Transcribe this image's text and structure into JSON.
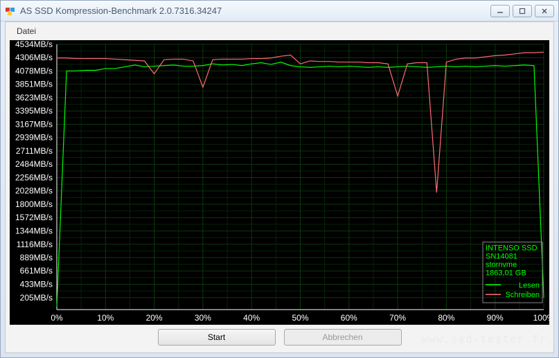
{
  "window": {
    "title": "AS SSD Kompression-Benchmark 2.0.7316.34247"
  },
  "menu": {
    "file": "Datei"
  },
  "legend": {
    "device": "INTENSO SSD",
    "serial": "SN14081",
    "driver": "stornvme",
    "capacity": "1863,01 GB",
    "read": "Lesen",
    "write": "Schreiben"
  },
  "buttons": {
    "start": "Start",
    "cancel": "Abbrechen"
  },
  "watermark": "www.ssd-tester.fr",
  "chart_data": {
    "type": "line",
    "title": "",
    "xlabel": "",
    "ylabel": "",
    "xlim": [
      0,
      100
    ],
    "ylim": [
      0,
      4534
    ],
    "x_tick_labels": [
      "0%",
      "10%",
      "20%",
      "30%",
      "40%",
      "50%",
      "60%",
      "70%",
      "80%",
      "90%",
      "100%"
    ],
    "y_tick_labels": [
      "205MB/s",
      "433MB/s",
      "661MB/s",
      "889MB/s",
      "1116MB/s",
      "1344MB/s",
      "1572MB/s",
      "1800MB/s",
      "2028MB/s",
      "2256MB/s",
      "2484MB/s",
      "2711MB/s",
      "2939MB/s",
      "3167MB/s",
      "3395MB/s",
      "3623MB/s",
      "3851MB/s",
      "4078MB/s",
      "4306MB/s",
      "4534MB/s"
    ],
    "y_tick_values": [
      205,
      433,
      661,
      889,
      1116,
      1344,
      1572,
      1800,
      2028,
      2256,
      2484,
      2711,
      2939,
      3167,
      3395,
      3623,
      3851,
      4078,
      4306,
      4534
    ],
    "categories": [
      0,
      2,
      4,
      6,
      8,
      10,
      12,
      14,
      16,
      18,
      20,
      22,
      24,
      26,
      28,
      30,
      32,
      34,
      36,
      38,
      40,
      42,
      44,
      46,
      48,
      50,
      52,
      54,
      56,
      58,
      60,
      62,
      64,
      66,
      68,
      70,
      72,
      74,
      76,
      78,
      80,
      82,
      84,
      86,
      88,
      90,
      92,
      94,
      96,
      98,
      100
    ],
    "series": [
      {
        "name": "Lesen",
        "color": "#00ff00",
        "values": [
          50,
          4078,
          4078,
          4090,
          4090,
          4120,
          4120,
          4150,
          4180,
          4150,
          4160,
          4170,
          4180,
          4160,
          4160,
          4170,
          4200,
          4180,
          4190,
          4170,
          4200,
          4220,
          4190,
          4230,
          4170,
          4150,
          4140,
          4150,
          4160,
          4150,
          4160,
          4150,
          4140,
          4150,
          4140,
          4150,
          4160,
          4150,
          4140,
          4150,
          4160,
          4150,
          4160,
          4150,
          4160,
          4170,
          4160,
          4170,
          4180,
          4170,
          200
        ]
      },
      {
        "name": "Schreiben",
        "color": "#ff6b7a",
        "values": [
          4300,
          4300,
          4290,
          4290,
          4290,
          4290,
          4280,
          4270,
          4260,
          4250,
          4030,
          4270,
          4280,
          4280,
          4250,
          3800,
          4270,
          4280,
          4280,
          4280,
          4290,
          4290,
          4300,
          4330,
          4350,
          4200,
          4250,
          4240,
          4240,
          4230,
          4230,
          4230,
          4220,
          4220,
          4200,
          3650,
          4200,
          4220,
          4220,
          2000,
          4230,
          4280,
          4300,
          4300,
          4320,
          4340,
          4350,
          4370,
          4390,
          4390,
          4400
        ]
      }
    ]
  }
}
